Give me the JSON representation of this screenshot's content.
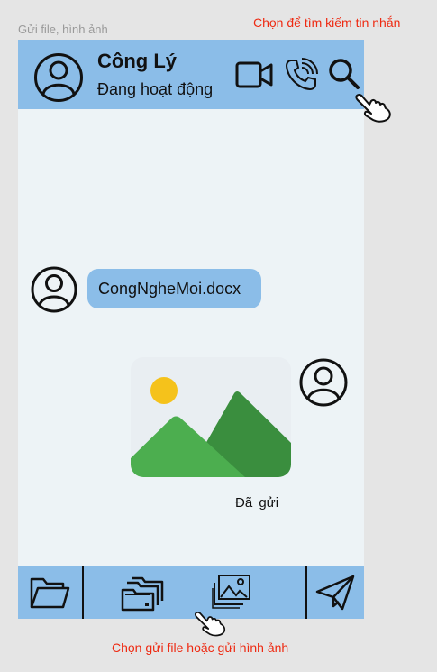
{
  "captions": {
    "top_left": "Gửi file, hình ảnh",
    "top_right": "Chọn để tìm kiếm tin nhắn",
    "bottom": "Chọn gửi file hoặc gửi hình ảnh"
  },
  "header": {
    "name": "Công Lý",
    "status": "Đang hoạt động",
    "icons": [
      "avatar-icon",
      "video-call-icon",
      "phone-call-icon",
      "search-icon"
    ]
  },
  "messages": {
    "file_message": {
      "filename": "CongNgheMoi.docx"
    },
    "image_message": {
      "status_label": "Đã  gửi"
    }
  },
  "footer": {
    "icons": [
      "folder-icon",
      "files-icon",
      "gallery-icon",
      "send-icon"
    ]
  },
  "colors": {
    "accent_blue": "#8bbde8",
    "annotation_red": "#ee2a12",
    "chat_background": "#edf3f6"
  }
}
